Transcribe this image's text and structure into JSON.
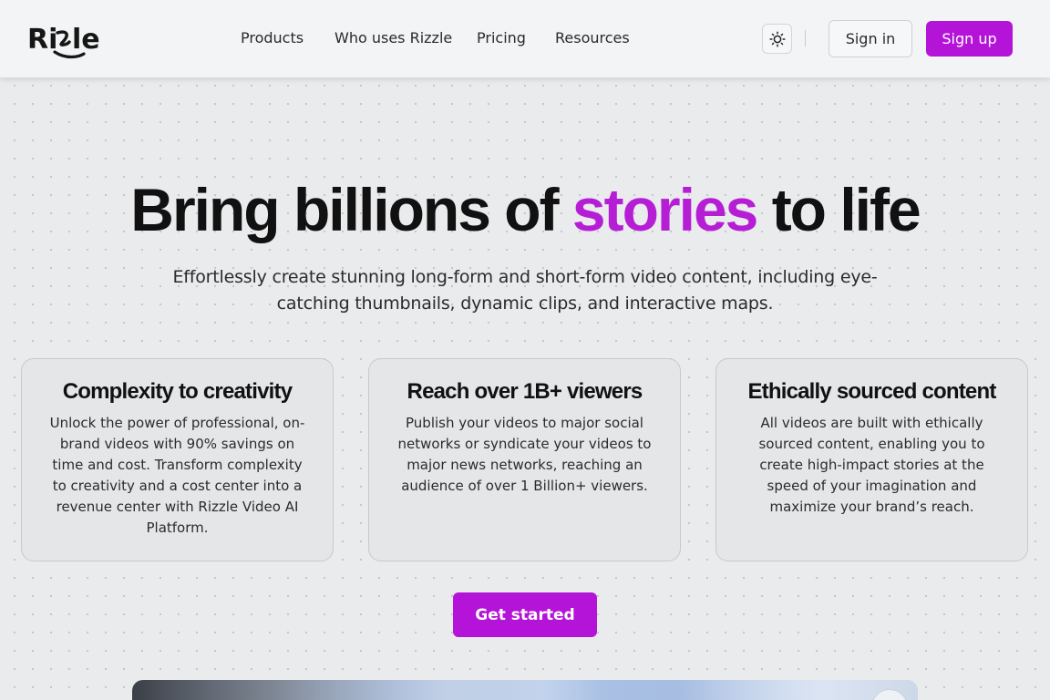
{
  "header": {
    "logo_text": "Rizzle",
    "nav": [
      "Products",
      "Who uses Rizzle",
      "Pricing",
      "Resources"
    ],
    "theme_toggle_icon": "sun-icon",
    "signin_label": "Sign in",
    "signup_label": "Sign up"
  },
  "hero": {
    "title_before": "Bring billions of ",
    "title_accent": "stories",
    "title_after": " to life",
    "subtitle": "Effortlessly create stunning long-form and short-form video content, including eye-catching thumbnails, dynamic clips, and interactive maps."
  },
  "cards": [
    {
      "title": "Complexity to creativity",
      "body": "Unlock the power of professional, on-brand videos with 90% savings on time and cost. Transform complexity to creativity and a cost center into a revenue center with Rizzle Video AI Platform."
    },
    {
      "title": "Reach over 1B+ viewers",
      "body": "Publish your videos to major social networks or syndicate your videos to major news networks, reaching an audience of over 1 Billion+ viewers."
    },
    {
      "title": "Ethically sourced content",
      "body": "All videos are built with ethically sourced content, enabling you to create high-impact stories at the speed of your imagination and maximize your brand’s reach."
    }
  ],
  "cta_label": "Get started",
  "colors": {
    "accent": "#b414d8",
    "background": "#e9ebec",
    "header_bg": "#f3f4f5"
  }
}
